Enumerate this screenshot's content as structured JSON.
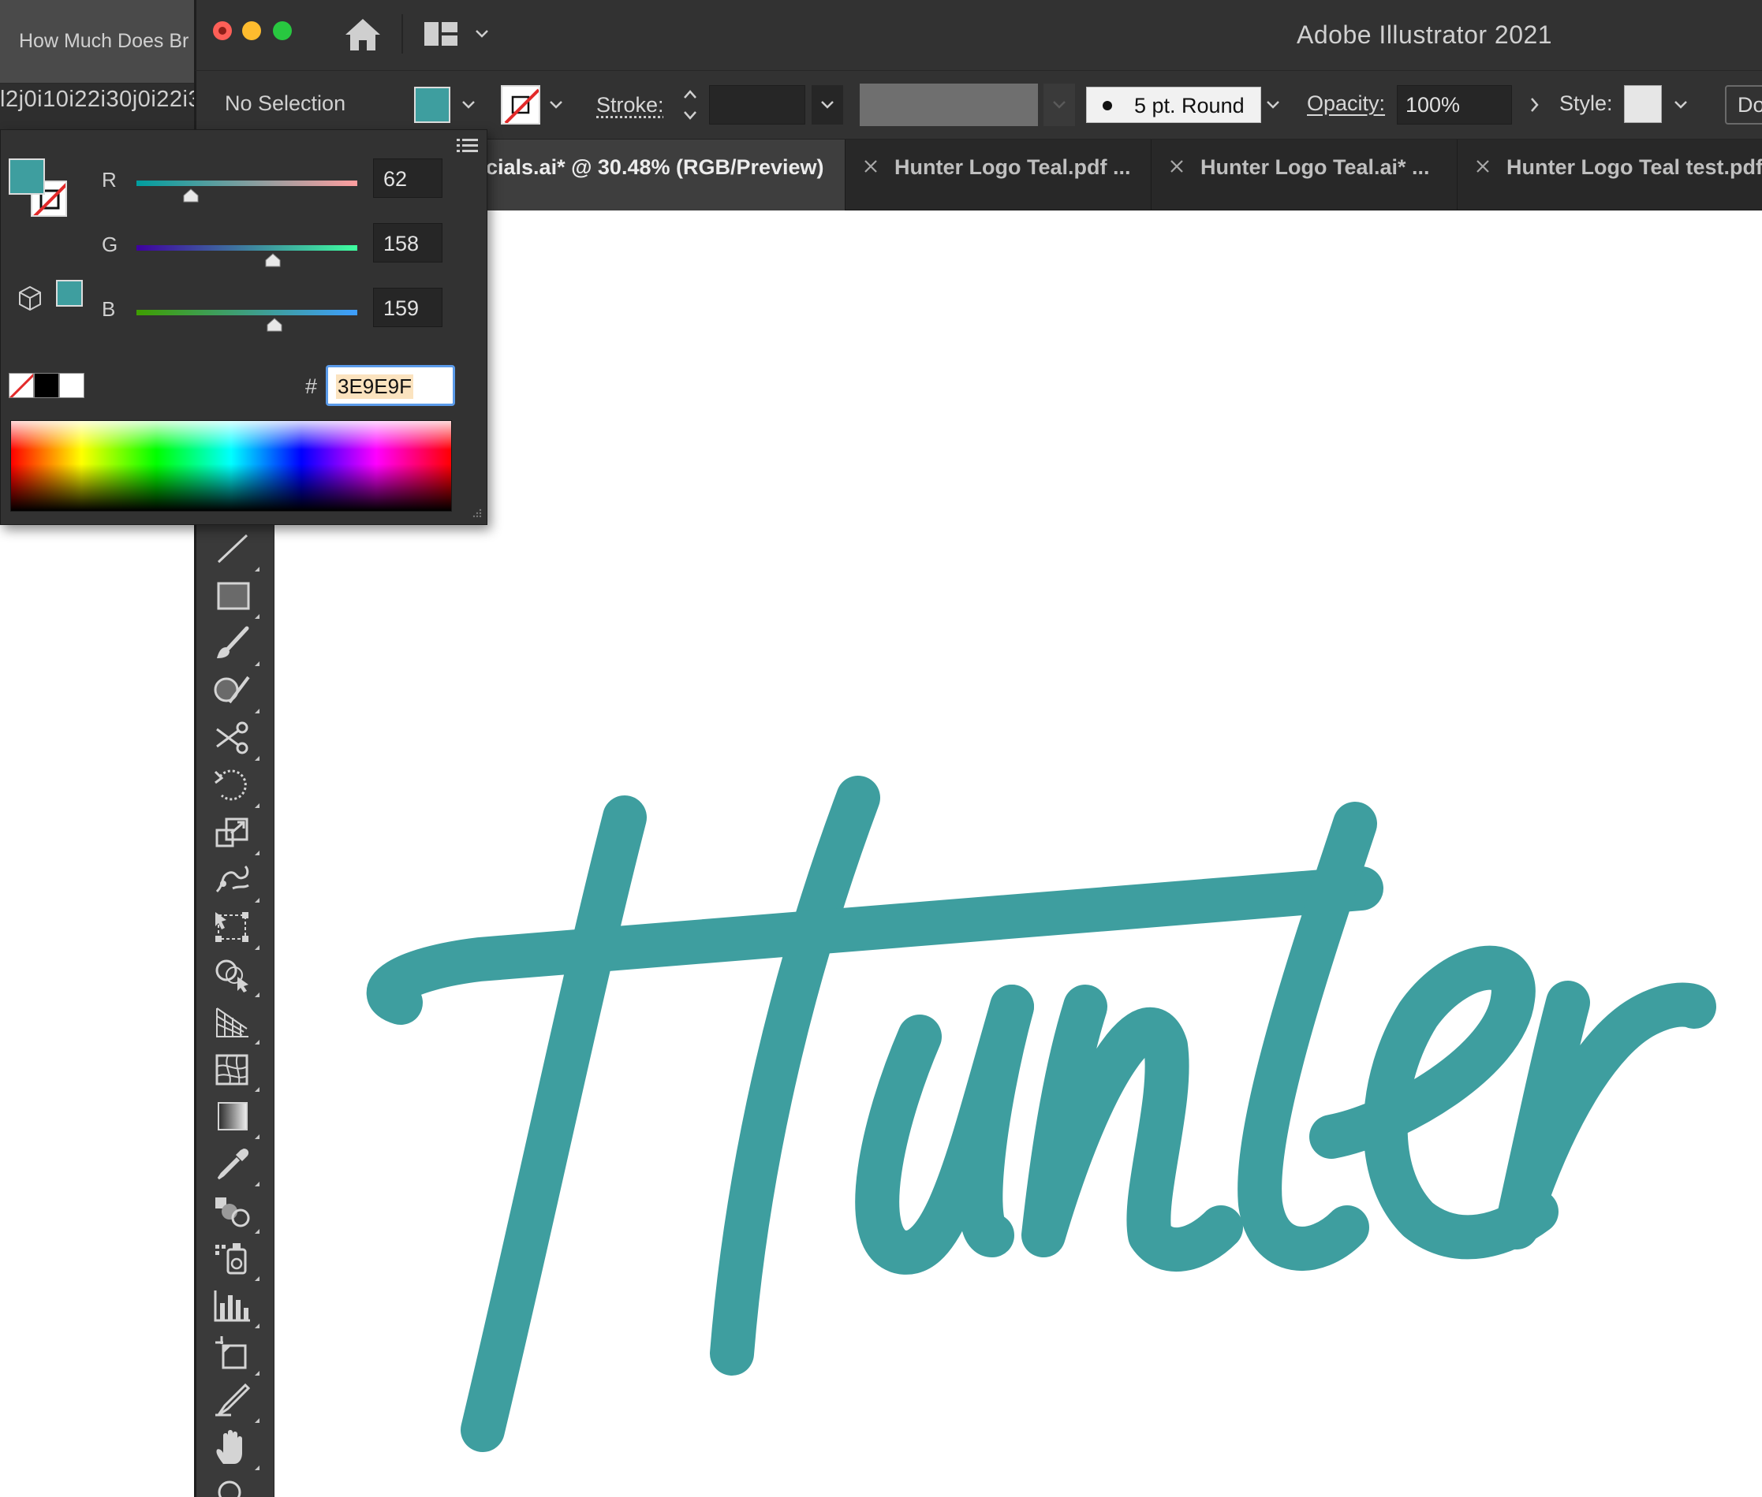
{
  "background_browser": {
    "tab_title": "How Much Does Br",
    "url_fragment": "l2j0i10i22i30j0i22i3"
  },
  "titlebar": {
    "app_title": "Adobe Illustrator 2021"
  },
  "control_bar": {
    "selection_label": "No Selection",
    "stroke_label": "Stroke:",
    "brush_label": "5 pt. Round",
    "opacity_label": "Opacity:",
    "opacity_value": "100%",
    "style_label": "Style:",
    "doc_setup_label": "Do"
  },
  "tabs": [
    {
      "label": "cials.ai* @ 30.48% (RGB/Preview)",
      "active": true
    },
    {
      "label": "Hunter Logo Teal.pdf ...",
      "active": false
    },
    {
      "label": "Hunter Logo Teal.ai* ...",
      "active": false
    },
    {
      "label": "Hunter Logo Teal test.pdf",
      "active": false
    }
  ],
  "color_panel": {
    "channels": [
      {
        "label": "R",
        "value": "62"
      },
      {
        "label": "G",
        "value": "158"
      },
      {
        "label": "B",
        "value": "159"
      }
    ],
    "hex_prefix": "#",
    "hex_value": "3E9E9F"
  },
  "colors": {
    "fill": "#3e9e9f",
    "ui_dark": "#323232",
    "ui_toolbar": "#3a3a3a",
    "canvas": "#ffffff",
    "focus": "#5b9bea"
  },
  "tools": [
    "line-segment-tool-icon",
    "rectangle-tool-icon",
    "paintbrush-tool-icon",
    "shaper-tool-icon",
    "scissors-tool-icon",
    "rotate-tool-icon",
    "scale-tool-icon",
    "warp-tool-icon",
    "free-transform-tool-icon",
    "shape-builder-tool-icon",
    "perspective-grid-tool-icon",
    "mesh-tool-icon",
    "gradient-tool-icon",
    "eyedropper-tool-icon",
    "blend-tool-icon",
    "symbol-sprayer-tool-icon",
    "column-graph-tool-icon",
    "artboard-tool-icon",
    "slice-tool-icon",
    "hand-tool-icon",
    "zoom-tool-icon"
  ]
}
